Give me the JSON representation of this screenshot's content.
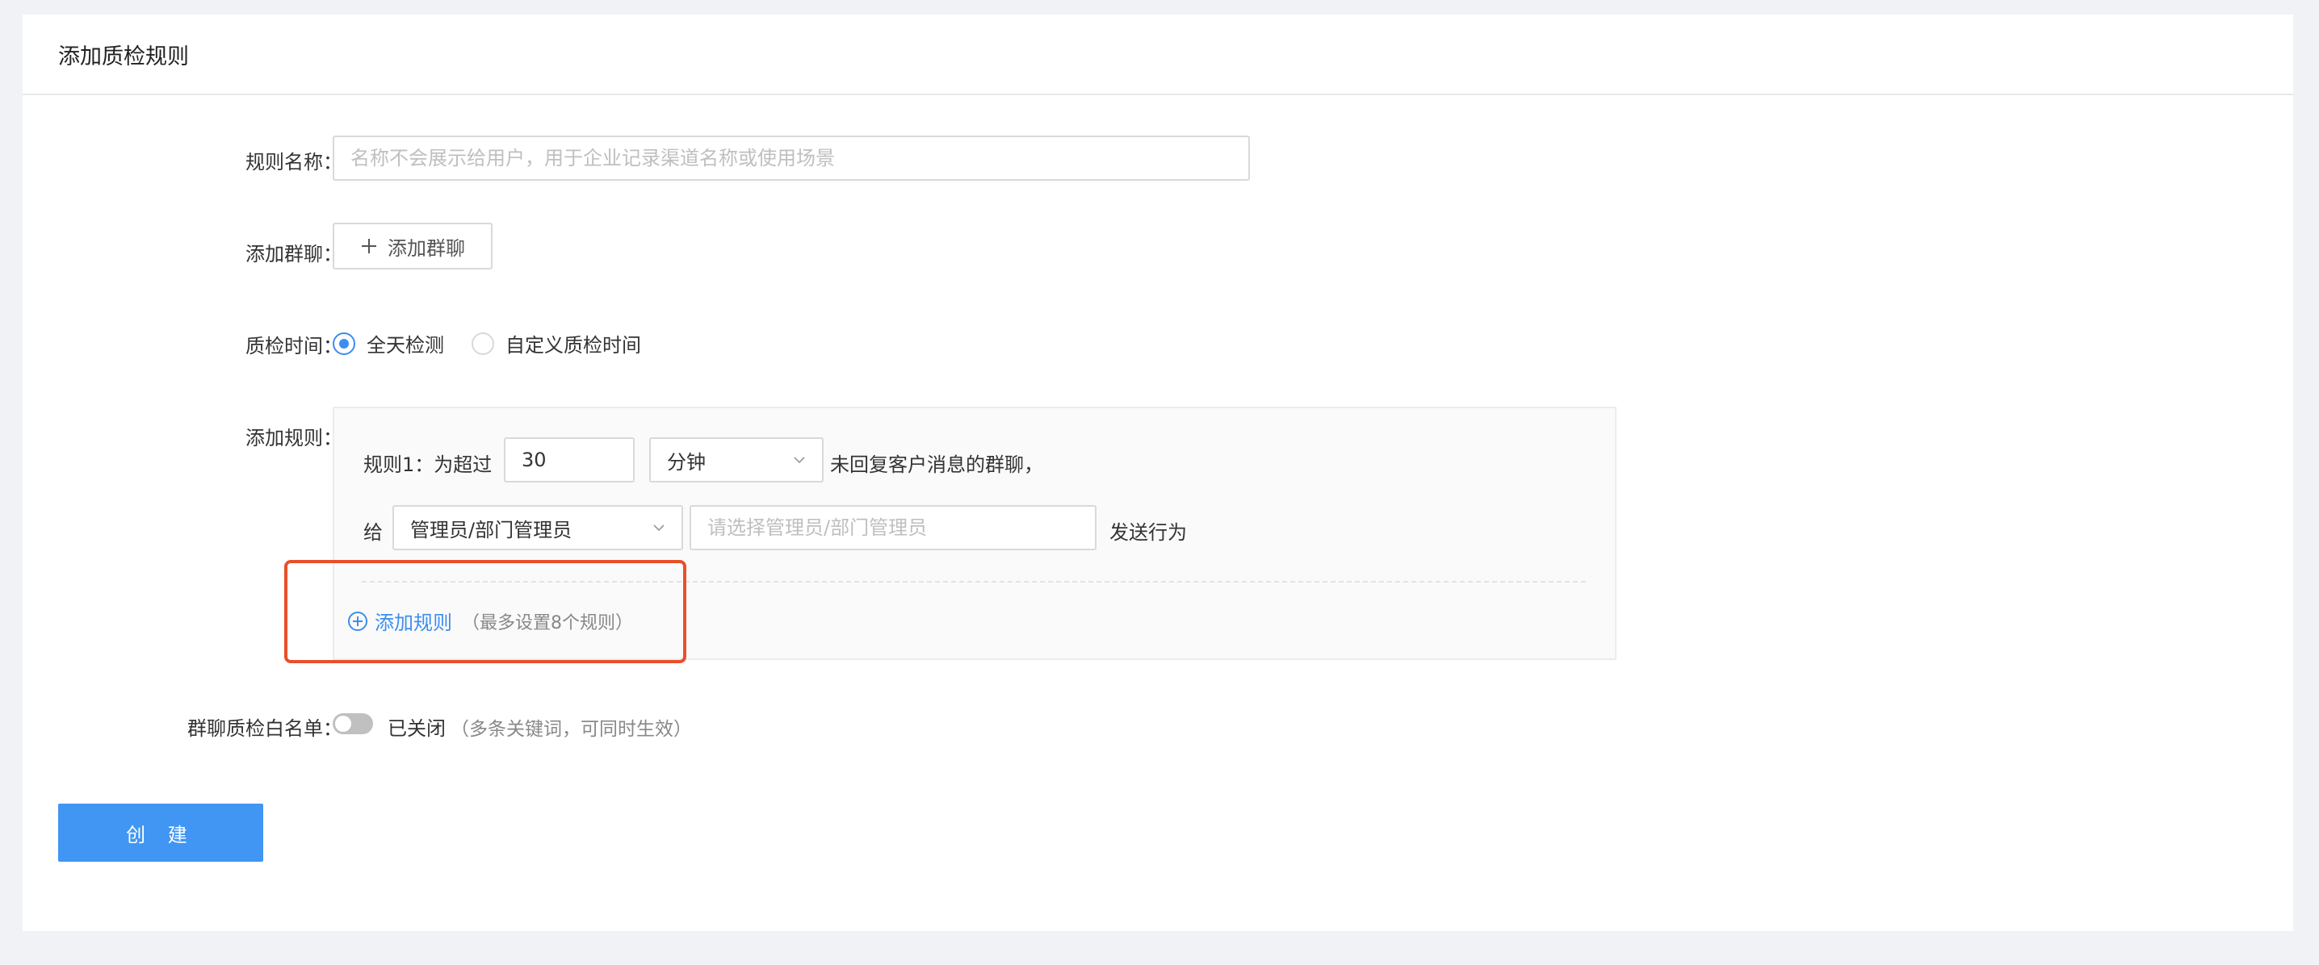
{
  "page": {
    "title": "添加质检规则"
  },
  "form": {
    "rule_name": {
      "label": "规则名称",
      "placeholder": "名称不会展示给用户，用于企业记录渠道名称或使用场景"
    },
    "group_chat": {
      "label": "添加群聊",
      "button_label": "添加群聊"
    },
    "check_time": {
      "label": "质检时间",
      "options": [
        "全天检测",
        "自定义质检时间"
      ],
      "selected": "全天检测"
    },
    "rules": {
      "label": "添加规则",
      "rule1": {
        "prefix": "规则1：为超过",
        "value": "30",
        "unit": "分钟",
        "suffix": "未回复客户消息的群聊，",
        "give_label": "给",
        "recipient_type": "管理员/部门管理员",
        "recipient_placeholder": "请选择管理员/部门管理员",
        "action_label": "发送行为"
      },
      "add_link": "添加规则",
      "add_hint": "（最多设置8个规则）"
    },
    "whitelist": {
      "label": "群聊质检白名单",
      "status": "已关闭",
      "hint": "（多条关键词，可同时生效）"
    },
    "submit": "创 建"
  },
  "colors": {
    "primary": "#4096f2",
    "highlight": "#e8502a",
    "link": "#3b8ef0"
  }
}
